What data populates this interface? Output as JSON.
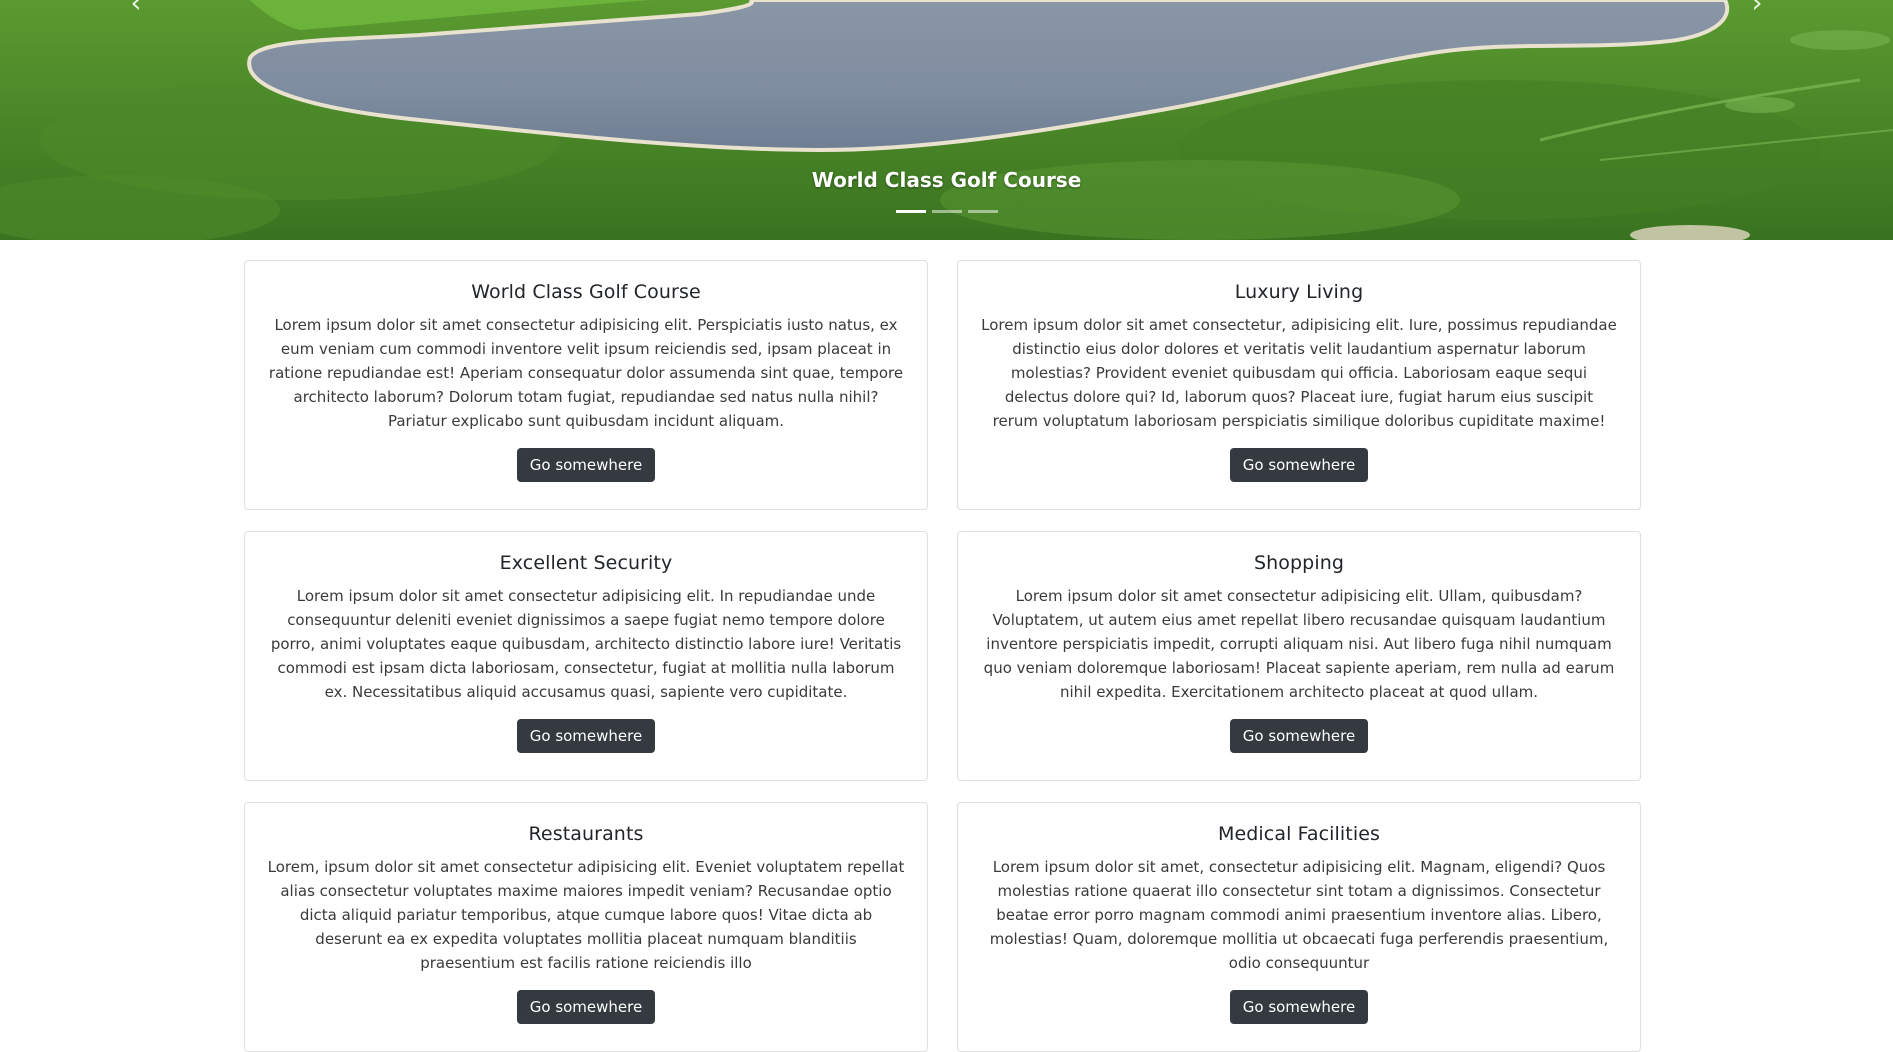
{
  "hero": {
    "caption": "World Class Golf Course",
    "prev_icon": "chevron-left-icon",
    "next_icon": "chevron-right-icon",
    "prev_glyph": "‹",
    "next_glyph": "›",
    "active_slide": 1,
    "slide_count": 3
  },
  "cards": [
    {
      "title": "World Class Golf Course",
      "text": "Lorem ipsum dolor sit amet consectetur adipisicing elit. Perspiciatis iusto natus, ex eum veniam cum commodi inventore velit ipsum reiciendis sed, ipsam placeat in ratione repudiandae est! Aperiam consequatur dolor assumenda sint quae, tempore architecto laborum? Dolorum totam fugiat, repudiandae sed natus nulla nihil? Pariatur explicabo sunt quibusdam incidunt aliquam.",
      "button": "Go somewhere"
    },
    {
      "title": "Luxury Living",
      "text": "Lorem ipsum dolor sit amet consectetur, adipisicing elit. Iure, possimus repudiandae distinctio eius dolor dolores et veritatis velit laudantium aspernatur laborum molestias? Provident eveniet quibusdam qui officia. Laboriosam eaque sequi delectus dolore qui? Id, laborum quos? Placeat iure, fugiat harum eius suscipit rerum voluptatum laboriosam perspiciatis similique doloribus cupiditate maxime!",
      "button": "Go somewhere"
    },
    {
      "title": "Excellent Security",
      "text": "Lorem ipsum dolor sit amet consectetur adipisicing elit. In repudiandae unde consequuntur deleniti eveniet dignissimos a saepe fugiat nemo tempore dolore porro, animi voluptates eaque quibusdam, architecto distinctio labore iure! Veritatis commodi est ipsam dicta laboriosam, consectetur, fugiat at mollitia nulla laborum ex. Necessitatibus aliquid accusamus quasi, sapiente vero cupiditate.",
      "button": "Go somewhere"
    },
    {
      "title": "Shopping",
      "text": "Lorem ipsum dolor sit amet consectetur adipisicing elit. Ullam, quibusdam? Voluptatem, ut autem eius amet repellat libero recusandae quisquam laudantium inventore perspiciatis impedit, corrupti aliquam nisi. Aut libero fuga nihil numquam quo veniam doloremque laboriosam! Placeat sapiente aperiam, rem nulla ad earum nihil expedita. Exercitationem architecto placeat at quod ullam.",
      "button": "Go somewhere"
    },
    {
      "title": "Restaurants",
      "text": "Lorem, ipsum dolor sit amet consectetur adipisicing elit. Eveniet voluptatem repellat alias consectetur voluptates maxime maiores impedit veniam? Recusandae optio dicta aliquid pariatur temporibus, atque cumque labore quos! Vitae dicta ab deserunt ea ex expedita voluptates mollitia placeat numquam blanditiis praesentium est facilis ratione reiciendis illo",
      "button": "Go somewhere"
    },
    {
      "title": "Medical Facilities",
      "text": "Lorem ipsum dolor sit amet, consectetur adipisicing elit. Magnam, eligendi? Quos molestias ratione quaerat illo consectetur sint totam a dignissimos. Consectetur beatae error porro magnam commodi animi praesentium inventore alias. Libero, molestias! Quam, doloremque mollitia ut obcaecati fuga perferendis praesentium, odio consequuntur",
      "button": "Go somewhere"
    }
  ],
  "colors": {
    "button_bg": "#343a40",
    "button_text": "#ffffff",
    "card_border": "#dfdfdf"
  }
}
